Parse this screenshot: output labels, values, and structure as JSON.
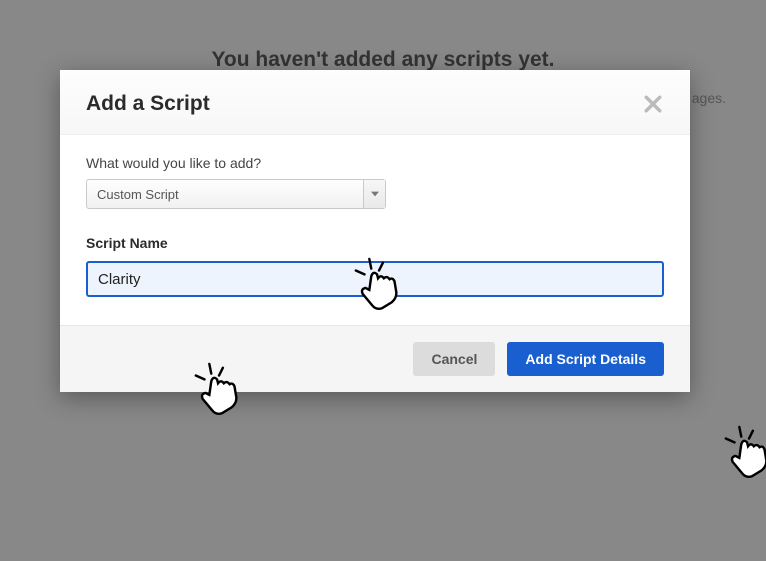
{
  "background": {
    "empty_heading": "You haven't added any scripts yet.",
    "sub_fragment": "ages."
  },
  "modal": {
    "title": "Add a Script",
    "prompt_label": "What would you like to add?",
    "selected_option": "Custom Script",
    "name_label": "Script Name",
    "name_value": "Clarity",
    "cancel_label": "Cancel",
    "submit_label": "Add Script Details"
  }
}
